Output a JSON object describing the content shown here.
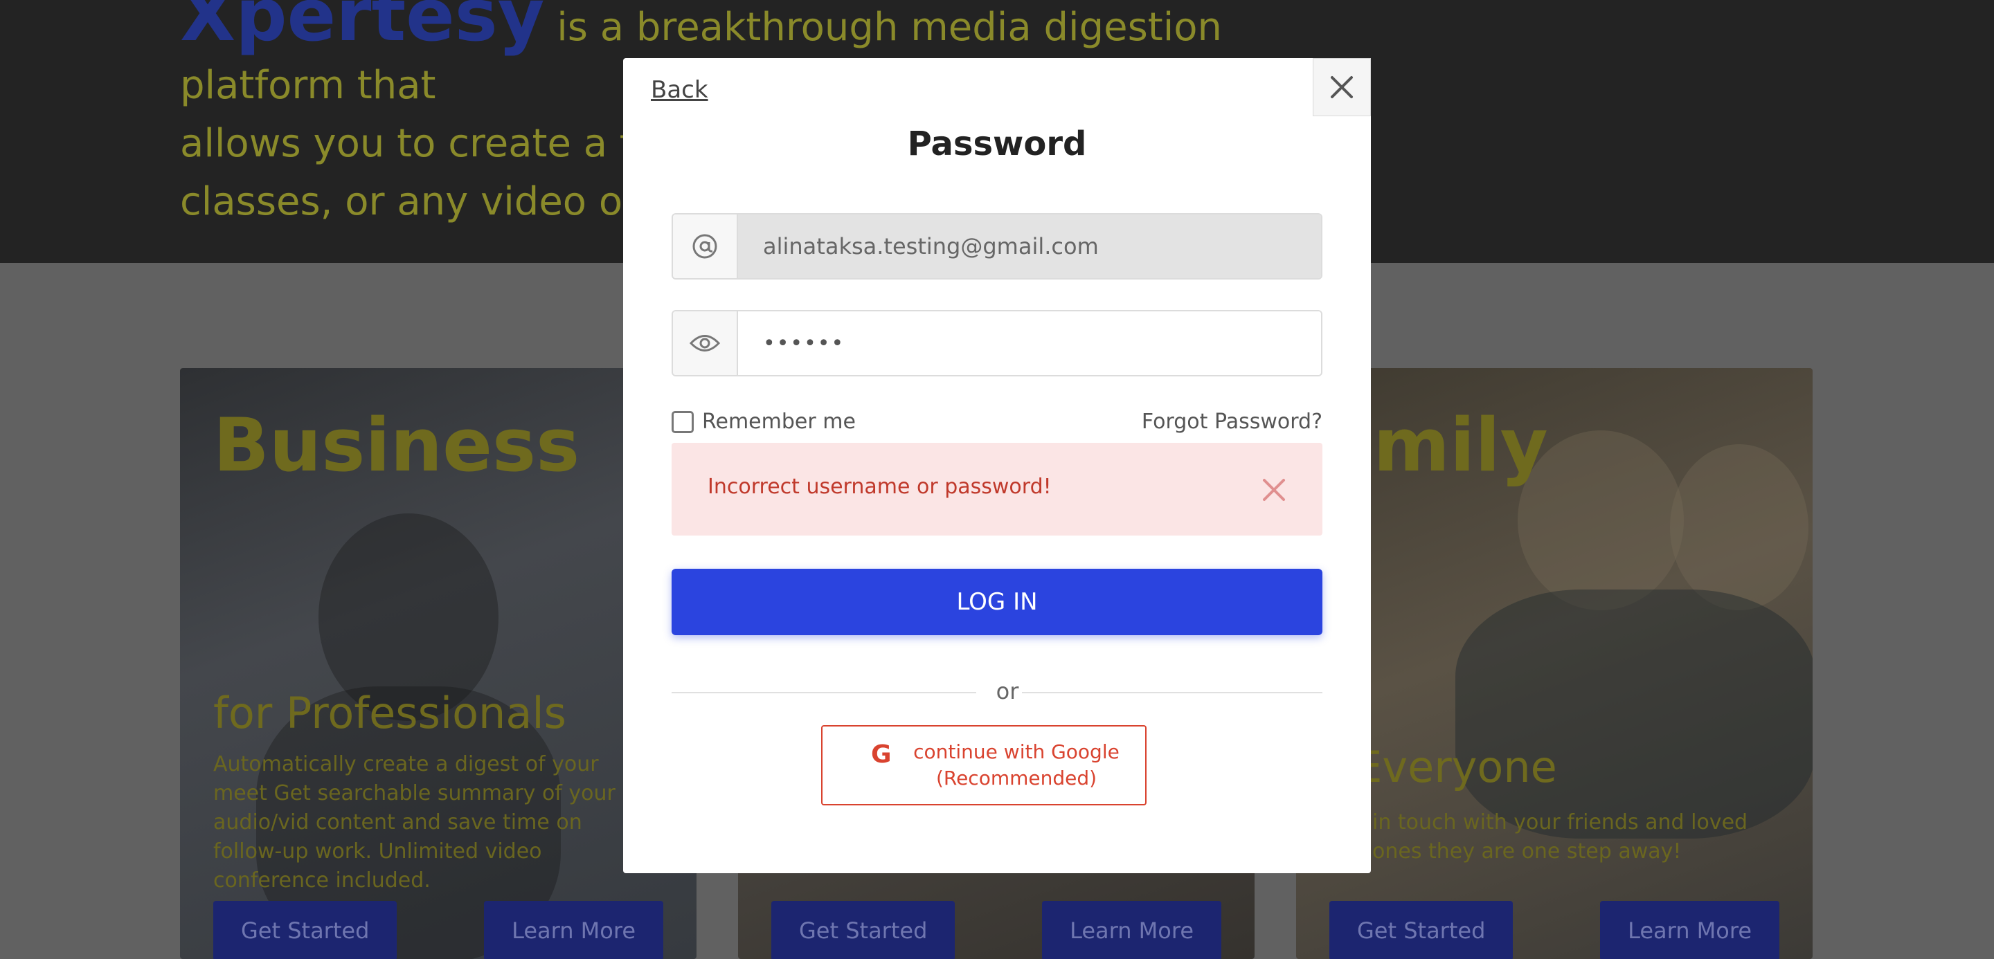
{
  "background": {
    "hero": {
      "brand": "Xpertesy",
      "text_line_1": " is a breakthrough media digestion platform that",
      "text_line_2": "allows you to create a full",
      "text_line_3": "classes, or any video or au"
    },
    "cards": [
      {
        "title": "Business",
        "subtitle": "for Professionals",
        "description": "Automatically create a digest of your meet Get searchable summary of your audio/vid content and save time on follow-up work. Unlimited video conference included.",
        "get_started": "Get Started",
        "learn_more": "Learn More"
      },
      {
        "get_started": "Get Started",
        "learn_more": "Learn More"
      },
      {
        "title": "amily",
        "subtitle": "r Everyone",
        "description": "in touch with your friends and loved ones they are one step away!",
        "get_started": "Get Started",
        "learn_more": "Learn More"
      }
    ]
  },
  "modal": {
    "back_label": "Back",
    "close_icon": "close-icon",
    "title": "Password",
    "email": {
      "icon": "at-icon",
      "value": "alinataksa.testing@gmail.com"
    },
    "password": {
      "icon": "eye-icon",
      "value": "••••••"
    },
    "remember_label": "Remember me",
    "remember_checked": false,
    "forgot_label": "Forgot Password?",
    "error": {
      "text": "Incorrect username or password!",
      "icon": "close-icon"
    },
    "login_label": "LOG IN",
    "divider_label": "or",
    "google": {
      "icon": "google-icon",
      "line_1": "continue with Google",
      "line_2": "(Recommended)"
    }
  },
  "colors": {
    "primary": "#2b44df",
    "error_bg": "#fbe5e5",
    "error_text": "#c0392b",
    "google_red": "#d9432f"
  }
}
